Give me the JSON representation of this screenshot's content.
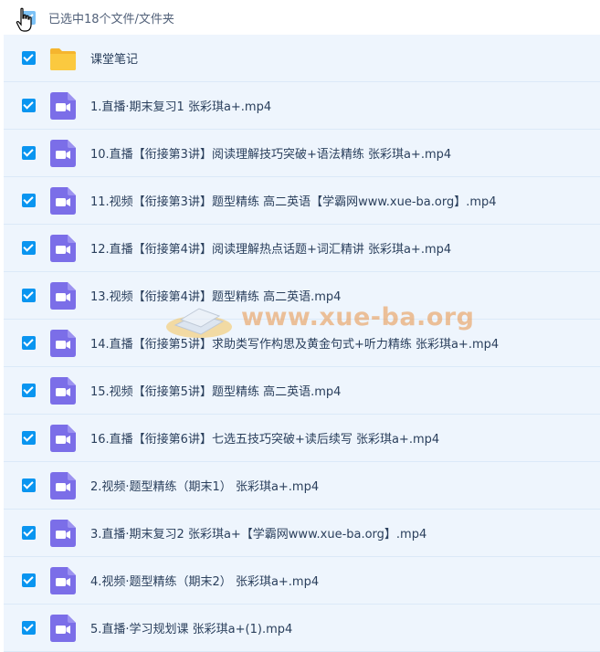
{
  "header": {
    "selection_text": "已选中18个文件/文件夹"
  },
  "watermark": {
    "text": "www.xue-ba.org"
  },
  "colors": {
    "checkbox": "#0a95f0",
    "row_bg": "#eef5fd",
    "video_icon": "#7b6ee8",
    "folder_icon": "#fbc93f"
  },
  "files": [
    {
      "type": "folder",
      "icon": "folder-icon",
      "name": "课堂笔记"
    },
    {
      "type": "video",
      "icon": "video-file-icon",
      "name": "1.直播·期末复习1 张彩琪a+.mp4"
    },
    {
      "type": "video",
      "icon": "video-file-icon",
      "name": "10.直播【衔接第3讲】阅读理解技巧突破+语法精练 张彩琪a+.mp4"
    },
    {
      "type": "video",
      "icon": "video-file-icon",
      "name": "11.视频【衔接第3讲】题型精练 高二英语【学霸网www.xue-ba.org】.mp4"
    },
    {
      "type": "video",
      "icon": "video-file-icon",
      "name": "12.直播【衔接第4讲】阅读理解热点话题+词汇精讲 张彩琪a+.mp4"
    },
    {
      "type": "video",
      "icon": "video-file-icon",
      "name": "13.视频【衔接第4讲】题型精练 高二英语.mp4"
    },
    {
      "type": "video",
      "icon": "video-file-icon",
      "name": "14.直播【衔接第5讲】求助类写作构思及黄金句式+听力精练 张彩琪a+.mp4"
    },
    {
      "type": "video",
      "icon": "video-file-icon",
      "name": "15.视频【衔接第5讲】题型精练 高二英语.mp4"
    },
    {
      "type": "video",
      "icon": "video-file-icon",
      "name": "16.直播【衔接第6讲】七选五技巧突破+读后续写 张彩琪a+.mp4"
    },
    {
      "type": "video",
      "icon": "video-file-icon",
      "name": "2.视频·题型精练（期末1） 张彩琪a+.mp4"
    },
    {
      "type": "video",
      "icon": "video-file-icon",
      "name": "3.直播·期末复习2 张彩琪a+【学霸网www.xue-ba.org】.mp4"
    },
    {
      "type": "video",
      "icon": "video-file-icon",
      "name": "4.视频·题型精练（期末2） 张彩琪a+.mp4"
    },
    {
      "type": "video",
      "icon": "video-file-icon",
      "name": "5.直播·学习规划课 张彩琪a+(1).mp4"
    }
  ]
}
